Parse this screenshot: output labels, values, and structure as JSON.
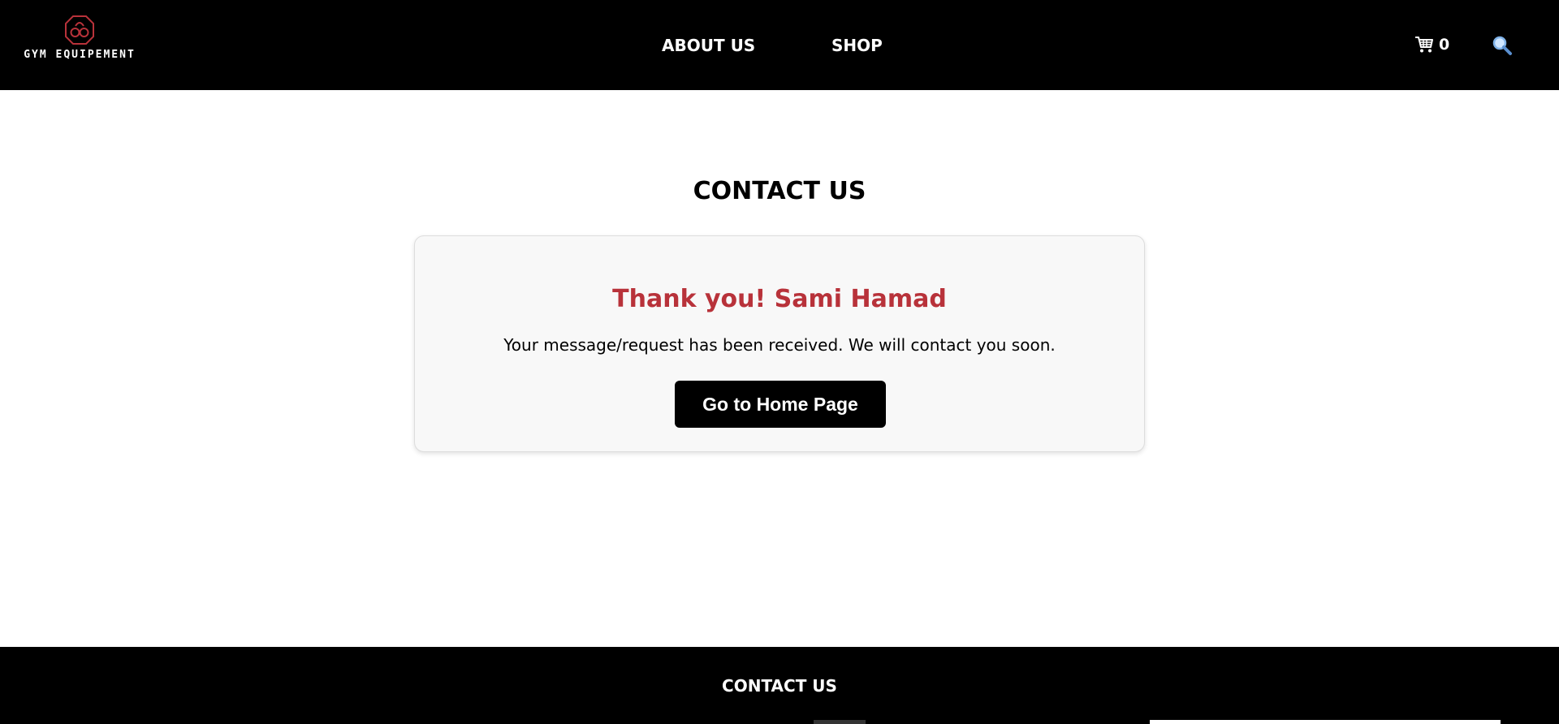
{
  "header": {
    "logo_text": "GYM EQUIPEMENT",
    "nav": [
      {
        "label": "ABOUT US"
      },
      {
        "label": "SHOP"
      }
    ],
    "cart_count": "0",
    "colors": {
      "background": "#000000",
      "text": "#ffffff",
      "logo_accent": "#b8323a"
    }
  },
  "main": {
    "title": "CONTACT US",
    "card": {
      "heading": "Thank you! Sami Hamad",
      "message": "Your message/request has been received. We will contact you soon.",
      "button_label": "Go to Home Page"
    },
    "colors": {
      "heading": "#b8323a",
      "card_bg": "#f8f8f8",
      "button_bg": "#000000"
    }
  },
  "footer": {
    "title": "CONTACT US"
  },
  "icons": {
    "logo": "kettlebell-octagon-icon",
    "cart": "shopping-cart-icon",
    "search": "magnifier-icon"
  }
}
